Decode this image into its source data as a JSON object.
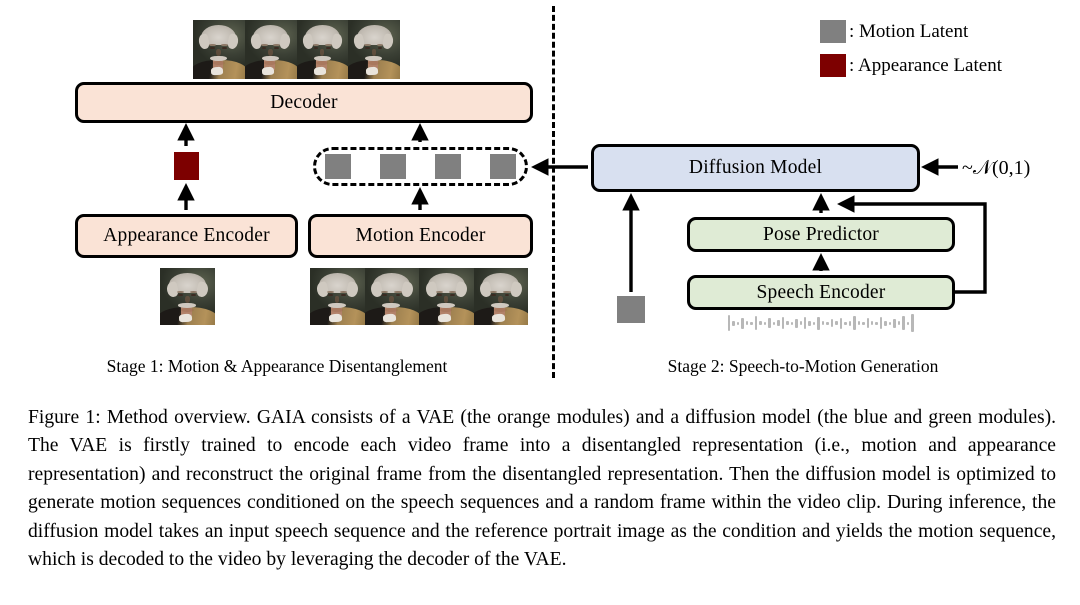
{
  "figure": {
    "stage1": {
      "label": "Stage 1: Motion & Appearance Disentanglement",
      "decoder": "Decoder",
      "appearance_encoder": "Appearance Encoder",
      "motion_encoder": "Motion Encoder",
      "output_frames_count": 4,
      "input_frames_count": 4,
      "appearance_input_frames_count": 1,
      "motion_latent_count": 4,
      "appearance_latent_count": 1
    },
    "stage2": {
      "label": "Stage 2: Speech-to-Motion Generation",
      "diffusion_model": "Diffusion Model",
      "pose_predictor": "Pose Predictor",
      "speech_encoder": "Speech Encoder",
      "noise_source": "~𝒩(0,1)",
      "reference_latent_count": 1,
      "waveform_bar_count": 42
    },
    "legend": [
      {
        "swatch": "gray",
        "label": ": Motion Latent",
        "color": "#808080"
      },
      {
        "swatch": "red",
        "label": ": Appearance Latent",
        "color": "#7d0000"
      }
    ],
    "colors": {
      "vae_orange": "#fae3d6",
      "diffusion_blue": "#d8e0f0",
      "speech_green": "#dfebd5",
      "motion_latent": "#808080",
      "appearance_latent": "#7d0000",
      "stroke": "#000000"
    },
    "icons": {
      "divider": "dash-dot-vertical-divider-icon",
      "waveform": "audio-waveform-icon",
      "arrow": "arrow-up-icon"
    }
  },
  "caption": {
    "text": "Figure 1: Method overview. GAIA consists of a VAE (the orange modules) and a diffusion model (the blue and green modules). The VAE is firstly trained to encode each video frame into a disentangled representation (i.e., motion and appearance representation) and reconstruct the original frame from the disentangled representation. Then the diffusion model is optimized to generate motion sequences conditioned on the speech sequences and a random frame within the video clip. During inference, the diffusion model takes an input speech sequence and the reference portrait image as the condition and yields the motion sequence, which is decoded to the video by leveraging the decoder of the VAE."
  }
}
